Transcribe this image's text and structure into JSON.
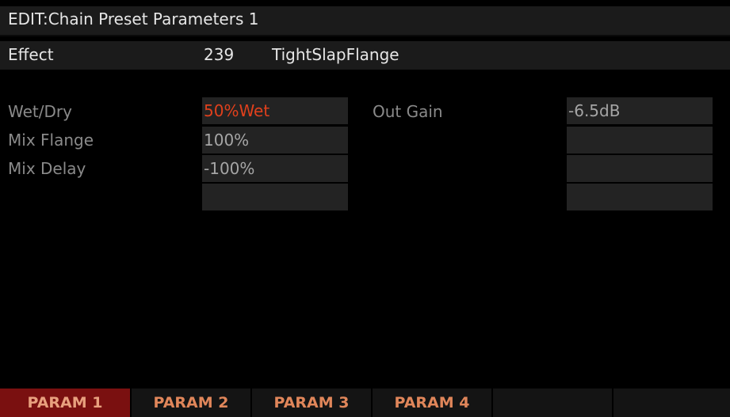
{
  "header": {
    "title": "EDIT:Chain Preset Parameters 1"
  },
  "effect": {
    "label": "Effect",
    "number": "239",
    "name": "TightSlapFlange"
  },
  "params": {
    "left": [
      {
        "label": "Wet/Dry",
        "value": "50%Wet"
      },
      {
        "label": "Mix Flange",
        "value": "100%"
      },
      {
        "label": "Mix Delay",
        "value": "-100%"
      },
      {
        "label": "",
        "value": ""
      }
    ],
    "right": [
      {
        "label": "Out Gain",
        "value": "-6.5dB"
      },
      {
        "label": "",
        "value": ""
      },
      {
        "label": "",
        "value": ""
      },
      {
        "label": "",
        "value": ""
      }
    ]
  },
  "softkeys": [
    "PARAM 1",
    "PARAM 2",
    "PARAM 3",
    "PARAM 4",
    "",
    ""
  ],
  "colors": {
    "background": "#000000",
    "selected_value": "#e0401c",
    "active_tab": "#7a1010",
    "softkey_text": "#e0865a"
  }
}
